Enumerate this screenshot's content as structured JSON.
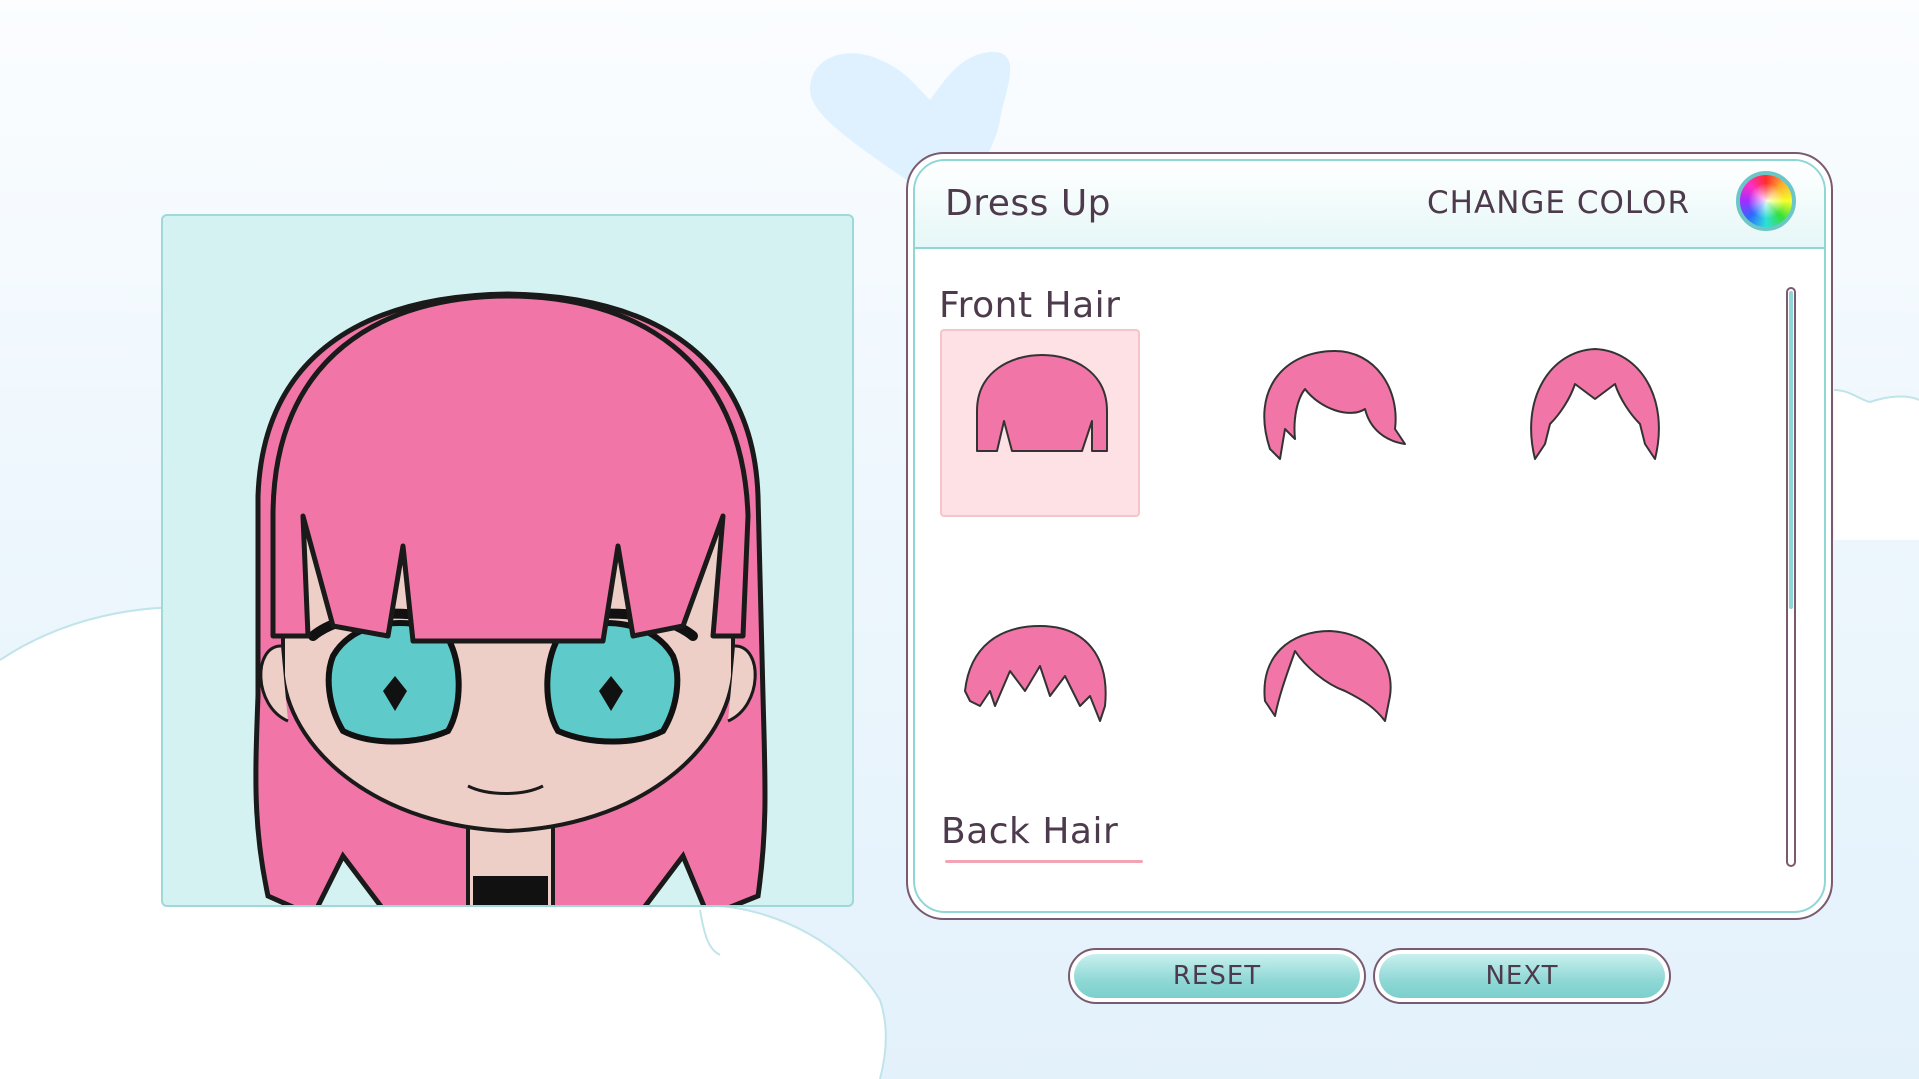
{
  "panel": {
    "title": "Dress Up",
    "change_color_label": "CHANGE COLOR"
  },
  "sections": {
    "front_hair": "Front Hair",
    "back_hair": "Back Hair"
  },
  "front_hair_items": [
    {
      "icon": "bangs-straight-icon",
      "selected": true
    },
    {
      "icon": "bangs-side-swept-icon",
      "selected": false
    },
    {
      "icon": "bangs-parted-icon",
      "selected": false
    },
    {
      "icon": "bangs-messy-icon",
      "selected": false
    },
    {
      "icon": "bangs-sweep-icon",
      "selected": false
    }
  ],
  "buttons": {
    "reset": "RESET",
    "next": "NEXT"
  },
  "colors": {
    "hair": "#f176a7",
    "skin": "#eecfc7",
    "eyes": "#5ecaca",
    "accent": "#8fd6d6",
    "outline": "#7a5a6e"
  }
}
